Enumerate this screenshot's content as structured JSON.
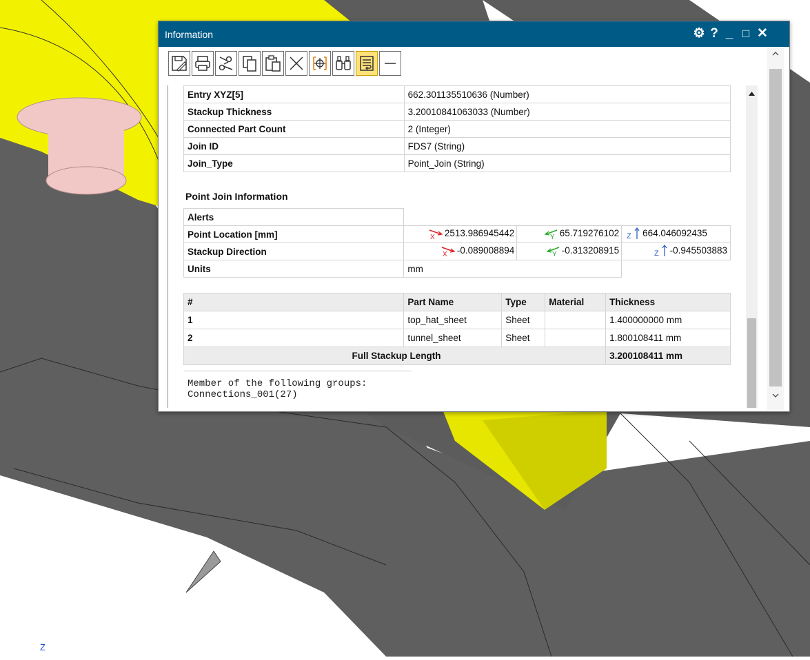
{
  "window": {
    "title": "Information",
    "controls": {
      "settings": "⚙",
      "help": "?",
      "minimize": "_",
      "maximize": "□",
      "close": "✕"
    }
  },
  "toolbar": {
    "buttons": [
      {
        "name": "save-icon"
      },
      {
        "name": "print-icon"
      },
      {
        "name": "scissors-icon"
      },
      {
        "name": "copy-icon"
      },
      {
        "name": "paste-icon"
      },
      {
        "name": "delete-icon"
      },
      {
        "name": "target-icon"
      },
      {
        "name": "find-icon"
      },
      {
        "name": "wrap-text-icon",
        "active": true
      },
      {
        "name": "collapse-icon"
      }
    ]
  },
  "attributes": [
    {
      "label": "Entry XYZ[5]",
      "value": "662.301135510636 (Number)"
    },
    {
      "label": "Stackup Thickness",
      "value": "3.20010841063033 (Number)"
    },
    {
      "label": "Connected Part Count",
      "value": "2 (Integer)"
    },
    {
      "label": "Join ID",
      "value": "FDS7 (String)"
    },
    {
      "label": "Join_Type",
      "value": "Point_Join (String)"
    }
  ],
  "point_join": {
    "section_title": "Point Join Information",
    "alerts_label": "Alerts",
    "location_label": "Point Location [mm]",
    "location": {
      "x": "2513.986945442",
      "y": "65.719276102",
      "z": "664.046092435"
    },
    "direction_label": "Stackup Direction",
    "direction": {
      "x": "-0.089008894",
      "y": "-0.313208915",
      "z": "-0.945503883"
    },
    "units_label": "Units",
    "units_value": "mm"
  },
  "stackup": {
    "headers": [
      "#",
      "Part Name",
      "Type",
      "Material",
      "Thickness"
    ],
    "rows": [
      {
        "num": "1",
        "part": "top_hat_sheet",
        "type": "Sheet",
        "material": "",
        "thickness": "1.400000000 mm"
      },
      {
        "num": "2",
        "part": "tunnel_sheet",
        "type": "Sheet",
        "material": "",
        "thickness": "1.800108411 mm"
      }
    ],
    "total_label": "Full Stackup Length",
    "total_value": "3.200108411 mm"
  },
  "groups": {
    "line1": "Member of the following groups:",
    "line2": "Connections_001(27)"
  },
  "viewport": {
    "axis_label": "Z",
    "colors": {
      "mesh": "#5f5f5f",
      "highlight": "#f2f200",
      "part_pink": "#f2c8c6"
    }
  }
}
